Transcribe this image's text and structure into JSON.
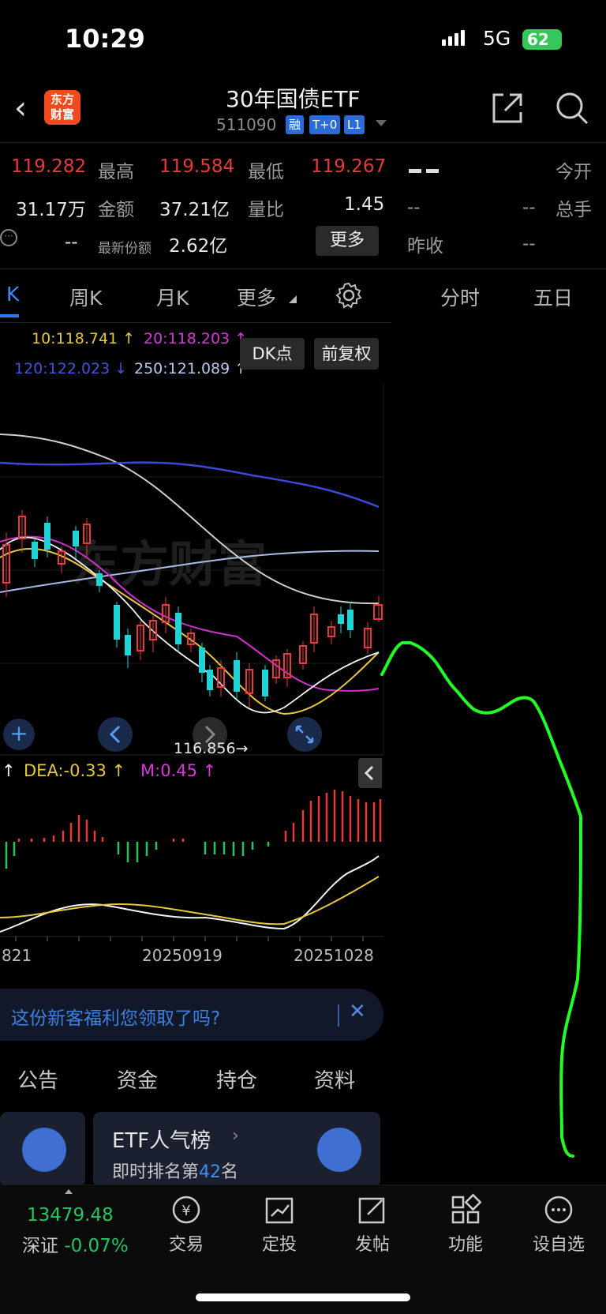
{
  "status_bar": {
    "time": "10:29",
    "network": "5G",
    "battery": "62"
  },
  "header": {
    "logo_line1": "东方",
    "logo_line2": "财富",
    "title": "30年国债ETF",
    "code": "511090",
    "badges": [
      "融",
      "T+0",
      "L1"
    ]
  },
  "quote": {
    "price": "119.282",
    "high_label": "最高",
    "high": "119.584",
    "low_label": "最低",
    "low": "119.267",
    "volume": "31.17万",
    "amount_label": "金额",
    "amount": "37.21亿",
    "vol_ratio_label": "量比",
    "vol_ratio": "1.45",
    "left_dash": "--",
    "latest_share_label": "最新份额",
    "latest_share": "2.62亿",
    "more_button": "更多",
    "open_dash": "--",
    "open_label": "今开",
    "r_dash1": "--",
    "r_dash2": "--",
    "total_label": "总手",
    "prev_label": "昨收",
    "prev_value": "--"
  },
  "tabs": {
    "k_partial": "K",
    "week": "周K",
    "month": "月K",
    "more": "更多",
    "intraday": "分时",
    "five_day": "五日"
  },
  "ma": {
    "ma10": "10:118.741 ↑",
    "ma20": "20:118.203 ↑",
    "ma120": "120:122.023 ↓",
    "ma250": "250:121.089 ↑",
    "dk_button": "DK点",
    "adjust_button": "前复权"
  },
  "chart": {
    "low_marker": "116.856→",
    "macd_labels": {
      "dea": "DEA:-0.33 ↑",
      "m": "M:0.45 ↑",
      "partial_arrow": "↑"
    },
    "dates": [
      "821",
      "20250919",
      "20251028"
    ]
  },
  "banner": {
    "text": "这份新客福利您领取了吗?",
    "close": "✕"
  },
  "sub_tabs": [
    "公告",
    "资金",
    "持仓",
    "资料"
  ],
  "rank_card": {
    "title": "ETF人气榜",
    "sub_prefix": "即时排名第",
    "rank": "42",
    "sub_suffix": "名"
  },
  "bottom": {
    "index_value": "13479.48",
    "index_name": "深证",
    "index_change": "-0.07%",
    "nav": [
      "交易",
      "定投",
      "发帖",
      "功能",
      "设自选"
    ]
  },
  "colors": {
    "up": "#e83a3a",
    "down": "#22d3d3",
    "accent": "#2b7df0",
    "annotation": "#22ff22"
  }
}
